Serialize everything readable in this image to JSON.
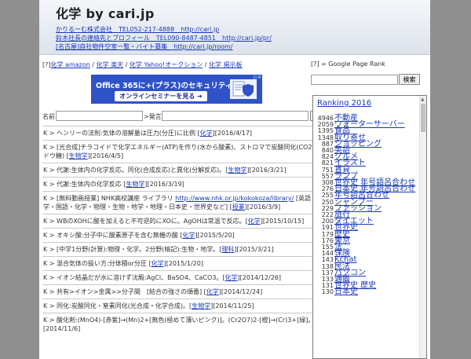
{
  "header": {
    "title": "化学 by cari.jp",
    "links": [
      "かりるーむ株式会社　TEL052-217-4888　http://cari.jp",
      "鈴木社長の連絡先とプロフィール　TEL090-8487-4851　http://cari.jp/pr/",
      "[名古屋]自社物件空室一覧・バイト募集　http://cari.jp/room/"
    ]
  },
  "topnav": {
    "prefix": "[?]",
    "links": [
      "化学 amazon",
      "化学 楽天",
      "化学 Yahoo!オークション",
      "化学 掲示板"
    ],
    "separator": " / "
  },
  "ad": {
    "headline": "Office 365に+(プラス)のセキュリティ",
    "button": "オンラインセミナーを見る ➔",
    "close": "▷✕"
  },
  "form": {
    "name_label": "名前",
    "comment_label": ">発言",
    "submit": "送信"
  },
  "posts": [
    {
      "parts": [
        {
          "t": "K > ヘンリーの法則:気体の溶解量は圧力(分圧)に比例 ["
        },
        {
          "t": "化学",
          "link": true
        },
        {
          "t": "][2016/4/17]"
        }
      ]
    },
    {
      "parts": [
        {
          "t": "K > [光合成]チラコイドで化学エネルギー(ATP)を作り(水から酸素)、ストロマで炭酸同化(CO2からブドウ糖) ["
        },
        {
          "t": "生物学",
          "link": true
        },
        {
          "t": "][2016/4/5]"
        }
      ]
    },
    {
      "parts": [
        {
          "t": "K > 代謝:生体内の化学反応。同化(合成反応)と異化(分解反応)。["
        },
        {
          "t": "生物学",
          "link": true
        },
        {
          "t": "][2016/3/21]"
        }
      ]
    },
    {
      "parts": [
        {
          "t": "K > 代謝:生体内の化学反応 ["
        },
        {
          "t": "生物学",
          "link": true
        },
        {
          "t": "][2016/3/19]"
        }
      ]
    },
    {
      "parts": [
        {
          "t": "K > [無料動画授業] NHK高校講座 ライブラリ "
        },
        {
          "t": "http://www.nhk.or.jp/kokokoza/library/",
          "link": true
        },
        {
          "t": " [英語・数学・国語・化学・物理・生物・地学・地理・日本史・世界史など] ["
        },
        {
          "t": "授業",
          "link": true
        },
        {
          "t": "][2016/3/9]"
        }
      ]
    },
    {
      "parts": [
        {
          "t": "K > WBのXOHに酸を加えると不可逆的にXOに。AgOHは常温で反応。["
        },
        {
          "t": "化学",
          "link": true
        },
        {
          "t": "][2015/10/15]"
        }
      ]
    },
    {
      "parts": [
        {
          "t": "K > オキシ酸:分子中に酸素原子を含む無機の酸 ["
        },
        {
          "t": "化学",
          "link": true
        },
        {
          "t": "][2015/5/20]"
        }
      ]
    },
    {
      "parts": [
        {
          "t": "K > [中学1分野(計算):物理・化学。2分野(暗記):生物・地学。["
        },
        {
          "t": "理科",
          "link": true
        },
        {
          "t": "][2015/3/21]"
        }
      ]
    },
    {
      "parts": [
        {
          "t": "K > 混合気体の扱い方:分体積or分圧 ["
        },
        {
          "t": "化学",
          "link": true
        },
        {
          "t": "][2015/1/20]"
        }
      ]
    },
    {
      "parts": [
        {
          "t": "K > イオン結晶だが水に溶けず沈殿:AgCl、BaSO4、CaCO3。["
        },
        {
          "t": "化学",
          "link": true
        },
        {
          "t": "][2014/12/26]"
        }
      ]
    },
    {
      "parts": [
        {
          "t": "K > 共有>イオン>金属>>分子間　[結合の強さの順番] ["
        },
        {
          "t": "化学",
          "link": true
        },
        {
          "t": "][2014/12/24]"
        }
      ]
    },
    {
      "parts": [
        {
          "t": "K > 同化:炭酸同化・窒素同化(光合成・化学合成)。["
        },
        {
          "t": "生物学",
          "link": true
        },
        {
          "t": "][2014/11/25]"
        }
      ]
    },
    {
      "parts": [
        {
          "t": "K > 酸化剤:(MnO4)-[赤紫]→(Mn)2+[無色(極めて薄いピンク)]。(Cr2O7)2-[橙]→(Cr)3+[緑]。["
        },
        {
          "t": "化学",
          "link": true
        },
        {
          "t": "][2014/11/6]"
        }
      ]
    }
  ],
  "sidebar": {
    "rank_note": "[?] = Google Page Rank",
    "search_btn": "検索",
    "ranking_title": "Ranking 2016",
    "ranking": [
      {
        "count": "4946",
        "kw": "不動産"
      },
      {
        "count": "2059",
        "kw": "ウォーターサーバー"
      },
      {
        "count": "1395",
        "kw": "食品"
      },
      {
        "count": "1348",
        "kw": "取り寄せ"
      },
      {
        "count": "887",
        "kw": "ショッピング"
      },
      {
        "count": "840",
        "kw": "英語"
      },
      {
        "count": "824",
        "kw": "グルメ"
      },
      {
        "count": "821",
        "kw": "イラスト"
      },
      {
        "count": "751",
        "kw": "賃貸"
      },
      {
        "count": "557",
        "kw": "ランプ"
      },
      {
        "count": "308",
        "kw": "世界史 年号語呂合わせ"
      },
      {
        "count": "276",
        "kw": "日本史 年号語呂合わせ"
      },
      {
        "count": "255",
        "kw": "年号語呂合わせ"
      },
      {
        "count": "250",
        "kw": "シャンプー"
      },
      {
        "count": "229",
        "kw": "ファッション"
      },
      {
        "count": "222",
        "kw": "旅行"
      },
      {
        "count": "200",
        "kw": "ダイエット"
      },
      {
        "count": "191",
        "kw": "世界史"
      },
      {
        "count": "179",
        "kw": "歴史"
      },
      {
        "count": "176",
        "kw": "東京"
      },
      {
        "count": "155",
        "kw": "法"
      },
      {
        "count": "144",
        "kw": "保険"
      },
      {
        "count": "143",
        "kw": "Kchat"
      },
      {
        "count": "138",
        "kw": "民法"
      },
      {
        "count": "137",
        "kw": "パソコン"
      },
      {
        "count": "133",
        "kw": "通販"
      },
      {
        "count": "131",
        "kw": "世界史 歴史"
      },
      {
        "count": "130",
        "kw": "日本史"
      }
    ]
  }
}
